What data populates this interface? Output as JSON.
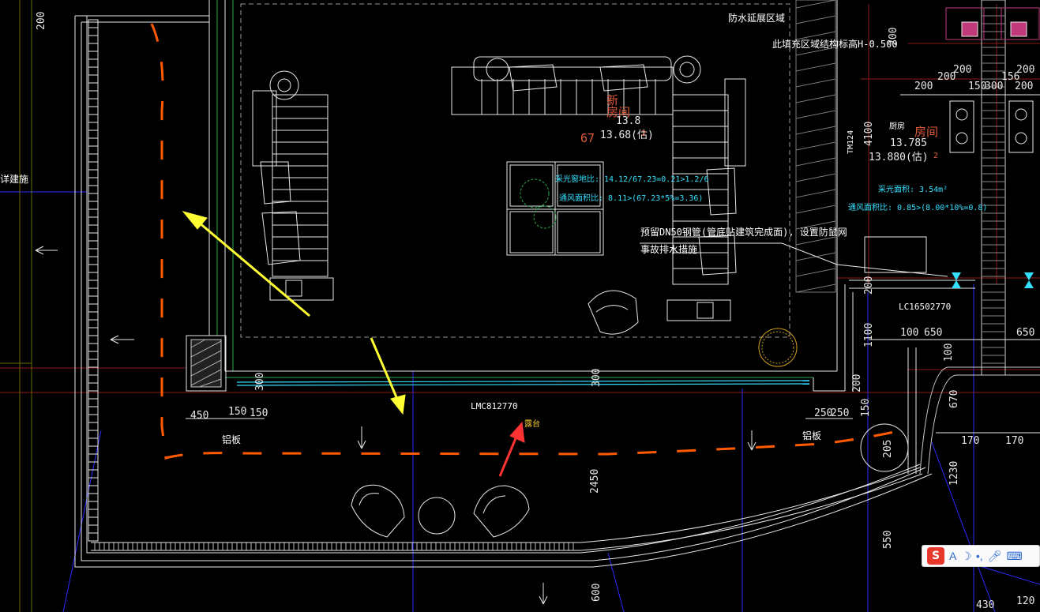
{
  "labels": {
    "waterproof_zone": "防水延展区域",
    "fill_zone": "此填充区域结构标高H-0.500",
    "room_name": "房间",
    "room_num_left": "新",
    "room_area_left_a": "13.8",
    "room_area_left_b": "13.68(估)",
    "room_area_left_c": "67",
    "room_area_left_unit": "2",
    "room_right_sub": "厨房",
    "room_area_right_a": "13.785",
    "room_area_right_b": "13.880(估)",
    "room_area_right_unit": "2",
    "light_ratio": "采光窗地比: 14.12/67.23=0.21>1.2/6",
    "vent_ratio": "通风面积比: 8.11>(67.23*5%=3.36)",
    "light_area_right": "采光面积: 3.54m²",
    "vent_ratio_right": "通风面积比: 0.85>(8.00*10%=0.8)",
    "pipe_note_1": "预留DN50钢管(管底贴建筑完成面), 设置防鼠网",
    "pipe_note_2": "事故排水措施",
    "door_code_right": "LC16502770",
    "door_code_main": "LMC812770",
    "balcony": "露台",
    "aluminum_left": "铝板",
    "aluminum_right": "铝板",
    "left_edge_text": "详建施",
    "tm": "TM124",
    "v4100": "4100"
  },
  "dims": {
    "d200_top": "200",
    "d200_r1": "200",
    "d200_r2": "200",
    "d200_r3": "200",
    "d150": "150",
    "d300a": "300",
    "d156": "156",
    "d200_r4": "200",
    "d200_r5": "200",
    "d450": "450",
    "d150b": "150",
    "d150c": "150",
    "d300v": "300",
    "d300v2": "300",
    "d250": "250",
    "d250b": "250",
    "d150v": "150",
    "d200v": "200",
    "d1100": "1100",
    "d100": "100",
    "d650a": "650",
    "d650b": "650",
    "d100v": "100",
    "d670": "670",
    "d170a": "170",
    "d170b": "170",
    "d1230": "1230",
    "d205": "205",
    "d2450": "2450",
    "d550": "550",
    "d600": "600",
    "d430": "430",
    "d120": "120"
  },
  "ime": {
    "letter": "A",
    "logo": "S"
  },
  "colors": {
    "background": "#000000",
    "wall": "#e8e8e8",
    "orange_dash": "#ff5a00",
    "arrow_yellow": "#ffff33",
    "arrow_red": "#ff3333",
    "blue_line": "#2b2bff",
    "cyan": "#33e0ff"
  }
}
